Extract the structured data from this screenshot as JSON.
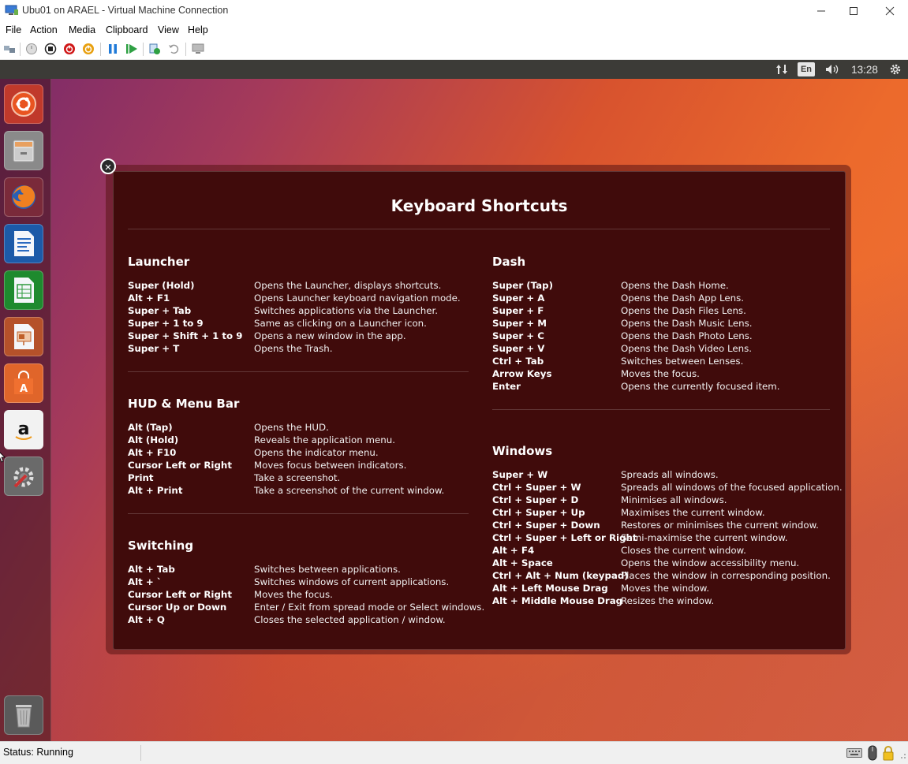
{
  "window": {
    "title": "Ubu01 on ARAEL - Virtual Machine Connection",
    "controls": [
      "minimize-icon",
      "maximize-icon",
      "close-icon"
    ]
  },
  "menu": [
    "File",
    "Action",
    "Media",
    "Clipboard",
    "View",
    "Help"
  ],
  "toolbar": [
    "ctrl-alt-del-icon",
    "start-icon",
    "turn-off-icon",
    "shut-down-icon",
    "save-icon",
    "pause-icon",
    "reset-icon",
    "checkpoint-icon",
    "revert-icon",
    "enhanced-session-icon"
  ],
  "panel": {
    "keyboard_layout": "En",
    "clock": "13:28"
  },
  "launcher": [
    "dash-home",
    "files",
    "firefox",
    "libreoffice-writer",
    "libreoffice-calc",
    "libreoffice-impress",
    "ubuntu-software",
    "amazon",
    "system-settings",
    "trash"
  ],
  "shortcuts": {
    "title": "Keyboard Shortcuts",
    "left": [
      {
        "name": "Launcher",
        "items": [
          {
            "key": "Super (Hold)",
            "desc": "Opens the Launcher, displays shortcuts."
          },
          {
            "key": "Alt + F1",
            "desc": "Opens Launcher keyboard navigation mode."
          },
          {
            "key": "Super + Tab",
            "desc": "Switches applications via the Launcher."
          },
          {
            "key": "Super + 1 to 9",
            "desc": "Same as clicking on a Launcher icon."
          },
          {
            "key": "Super + Shift + 1 to 9",
            "desc": "Opens a new window in the app."
          },
          {
            "key": "Super + T",
            "desc": "Opens the Trash."
          }
        ]
      },
      {
        "name": "HUD & Menu Bar",
        "items": [
          {
            "key": "Alt (Tap)",
            "desc": "Opens the HUD."
          },
          {
            "key": "Alt (Hold)",
            "desc": "Reveals the application menu."
          },
          {
            "key": "Alt + F10",
            "desc": "Opens the indicator menu."
          },
          {
            "key": "Cursor Left or Right",
            "desc": "Moves focus between indicators."
          },
          {
            "key": "Print",
            "desc": "Take a screenshot."
          },
          {
            "key": "Alt + Print",
            "desc": "Take a screenshot of the current window."
          }
        ]
      },
      {
        "name": "Switching",
        "items": [
          {
            "key": "Alt + Tab",
            "desc": "Switches between applications."
          },
          {
            "key": "Alt + `",
            "desc": "Switches windows of current applications."
          },
          {
            "key": "Cursor Left or Right",
            "desc": "Moves the focus."
          },
          {
            "key": "Cursor Up or Down",
            "desc": "Enter / Exit from spread mode or Select windows."
          },
          {
            "key": "Alt + Q",
            "desc": "Closes the selected application / window."
          }
        ]
      }
    ],
    "right": [
      {
        "name": "Dash",
        "items": [
          {
            "key": "Super (Tap)",
            "desc": "Opens the Dash Home."
          },
          {
            "key": "Super + A",
            "desc": "Opens the Dash App Lens."
          },
          {
            "key": "Super + F",
            "desc": "Opens the Dash Files Lens."
          },
          {
            "key": "Super + M",
            "desc": "Opens the Dash Music Lens."
          },
          {
            "key": "Super + C",
            "desc": "Opens the Dash Photo Lens."
          },
          {
            "key": "Super + V",
            "desc": "Opens the Dash Video Lens."
          },
          {
            "key": "Ctrl + Tab",
            "desc": "Switches between Lenses."
          },
          {
            "key": "Arrow Keys",
            "desc": "Moves the focus."
          },
          {
            "key": "Enter",
            "desc": "Opens the currently focused item."
          }
        ]
      },
      {
        "name": "Windows",
        "items": [
          {
            "key": "Super + W",
            "desc": "Spreads all windows."
          },
          {
            "key": "Ctrl + Super + W",
            "desc": "Spreads all windows of the focused application."
          },
          {
            "key": "Ctrl + Super + D",
            "desc": "Minimises all windows."
          },
          {
            "key": "Ctrl + Super + Up",
            "desc": "Maximises the current window."
          },
          {
            "key": "Ctrl + Super + Down",
            "desc": "Restores or minimises the current window."
          },
          {
            "key": "Ctrl + Super + Left or Right",
            "desc": "Semi-maximise the current window."
          },
          {
            "key": "Alt + F4",
            "desc": "Closes the current window."
          },
          {
            "key": "Alt + Space",
            "desc": "Opens the window accessibility menu."
          },
          {
            "key": "Ctrl + Alt + Num (keypad)",
            "desc": "Places the window in corresponding position."
          },
          {
            "key": "Alt + Left Mouse Drag",
            "desc": "Moves the window."
          },
          {
            "key": "Alt + Middle Mouse Drag",
            "desc": "Resizes the window."
          }
        ]
      }
    ]
  },
  "status": {
    "text": "Status: Running"
  }
}
